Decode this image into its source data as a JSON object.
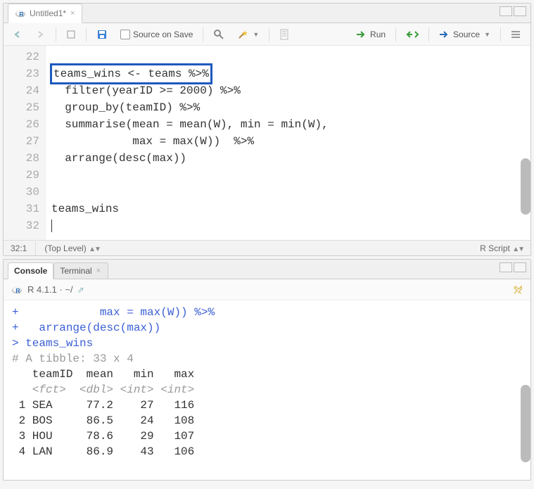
{
  "source": {
    "tab_title": "Untitled1*",
    "source_on_save_label": "Source on Save",
    "run_label": "Run",
    "source_label": "Source",
    "lines": {
      "22": "",
      "23_hl": "teams_wins <- teams %>%",
      "24": "  filter(yearID >= 2000) %>%",
      "25": "  group_by(teamID) %>%",
      "26": "  summarise(mean = mean(W), min = min(W),",
      "27": "            max = max(W))  %>%",
      "28": "  arrange(desc(max))",
      "29": "",
      "30": "",
      "31": "teams_wins",
      "32": ""
    },
    "gutter": [
      "22",
      "23",
      "24",
      "25",
      "26",
      "27",
      "28",
      "29",
      "30",
      "31",
      "32"
    ],
    "status_pos": "32:1",
    "status_scope": "(Top Level)",
    "status_type": "R Script"
  },
  "console": {
    "tabs": {
      "console": "Console",
      "terminal": "Terminal"
    },
    "session": "R 4.1.1 · ~/",
    "lines": [
      "+            max = max(W)) %>%",
      "+   arrange(desc(max))",
      "> teams_wins",
      "# A tibble: 33 x 4",
      "   teamID  mean   min   max",
      "   <fct>  <dbl> <int> <int>",
      " 1 SEA     77.2    27   116",
      " 2 BOS     86.5    24   108",
      " 3 HOU     78.6    29   107",
      " 4 LAN     86.9    43   106"
    ]
  },
  "chart_data": {
    "type": "table",
    "title": "teams_wins",
    "subtitle": "# A tibble: 33 x 4",
    "columns": [
      "teamID",
      "mean",
      "min",
      "max"
    ],
    "col_types": [
      "<fct>",
      "<dbl>",
      "<int>",
      "<int>"
    ],
    "rows": [
      {
        "teamID": "SEA",
        "mean": 77.2,
        "min": 27,
        "max": 116
      },
      {
        "teamID": "BOS",
        "mean": 86.5,
        "min": 24,
        "max": 108
      },
      {
        "teamID": "HOU",
        "mean": 78.6,
        "min": 29,
        "max": 107
      },
      {
        "teamID": "LAN",
        "mean": 86.9,
        "min": 43,
        "max": 106
      }
    ]
  }
}
